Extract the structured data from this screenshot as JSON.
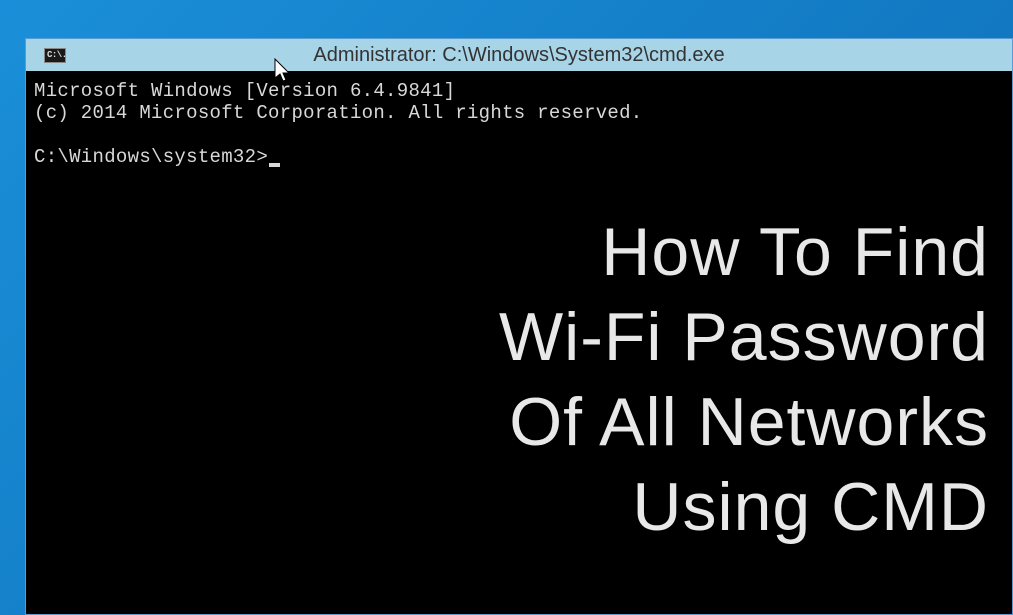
{
  "window": {
    "title": "Administrator: C:\\Windows\\System32\\cmd.exe",
    "icon_label": "C:\\."
  },
  "terminal": {
    "line1": "Microsoft Windows [Version 6.4.9841]",
    "line2": "(c) 2014 Microsoft Corporation. All rights reserved.",
    "prompt": "C:\\Windows\\system32>"
  },
  "overlay": {
    "line1": "How To Find",
    "line2": "Wi-Fi Password",
    "line3": "Of All Networks",
    "line4": "Using CMD"
  }
}
